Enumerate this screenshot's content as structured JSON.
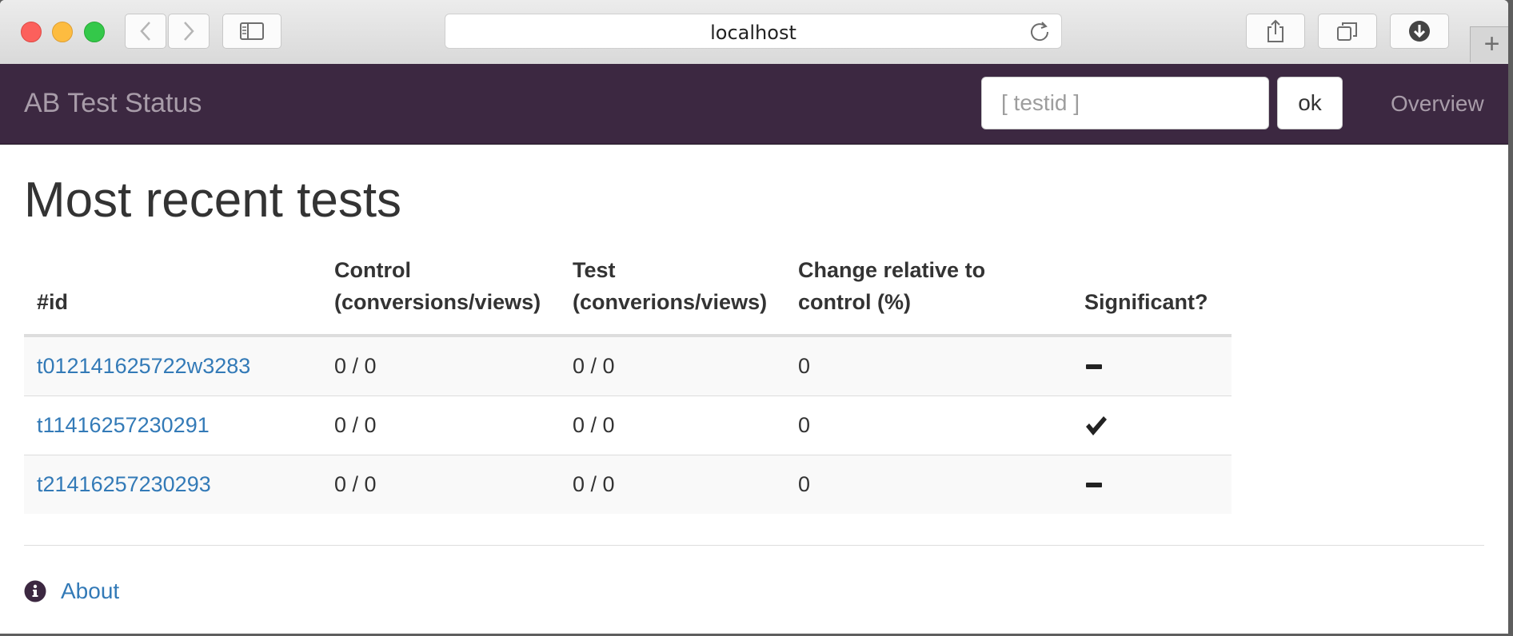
{
  "browser": {
    "url": "localhost"
  },
  "navbar": {
    "brand": "AB Test Status",
    "search_placeholder": "[ testid ]",
    "ok_label": "ok",
    "overview_label": "Overview"
  },
  "main": {
    "title": "Most recent tests",
    "table": {
      "headers": [
        "#id",
        "Control\n(conversions/views)",
        "Test\n(converions/views)",
        "Change relative to\ncontrol (%)",
        "Significant?"
      ],
      "rows": [
        {
          "id": "t012141625722w3283",
          "control": "0 / 0",
          "test": "0 / 0",
          "change": "0",
          "significant": "minus-icon"
        },
        {
          "id": "t11416257230291",
          "control": "0 / 0",
          "test": "0 / 0",
          "change": "0",
          "significant": "check-icon"
        },
        {
          "id": "t21416257230293",
          "control": "0 / 0",
          "test": "0 / 0",
          "change": "0",
          "significant": "minus-icon"
        }
      ]
    }
  },
  "footer": {
    "about_label": "About"
  },
  "colors": {
    "navbar_bg": "#3c2841",
    "link": "#337ab7"
  }
}
